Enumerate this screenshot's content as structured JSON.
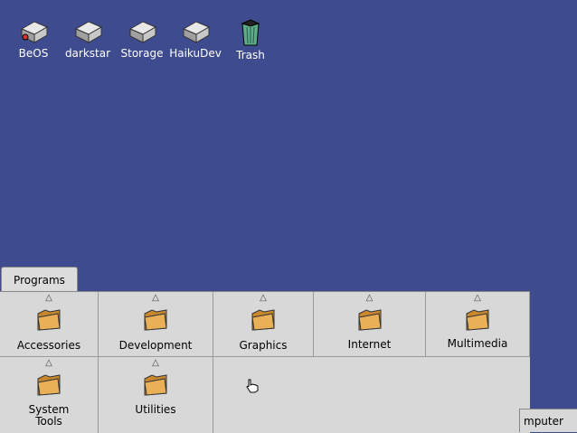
{
  "desktop": {
    "icons": [
      {
        "label": "BeOS",
        "type": "drive-icon"
      },
      {
        "label": "darkstar",
        "type": "drive-icon"
      },
      {
        "label": "Storage",
        "type": "drive-icon"
      },
      {
        "label": "HaikuDev",
        "type": "drive-icon"
      },
      {
        "label": "Trash",
        "type": "trash-icon"
      }
    ],
    "background_color": "#3f4b8f"
  },
  "window": {
    "tab_title": "Programs",
    "folders": [
      {
        "label": "Accessories"
      },
      {
        "label": "Development"
      },
      {
        "label": "Graphics"
      },
      {
        "label": "Internet"
      },
      {
        "label": "Multimedia"
      },
      {
        "label": "System\nTools"
      },
      {
        "label": "Utilities"
      }
    ]
  },
  "deskbar": {
    "label": "mputer"
  }
}
